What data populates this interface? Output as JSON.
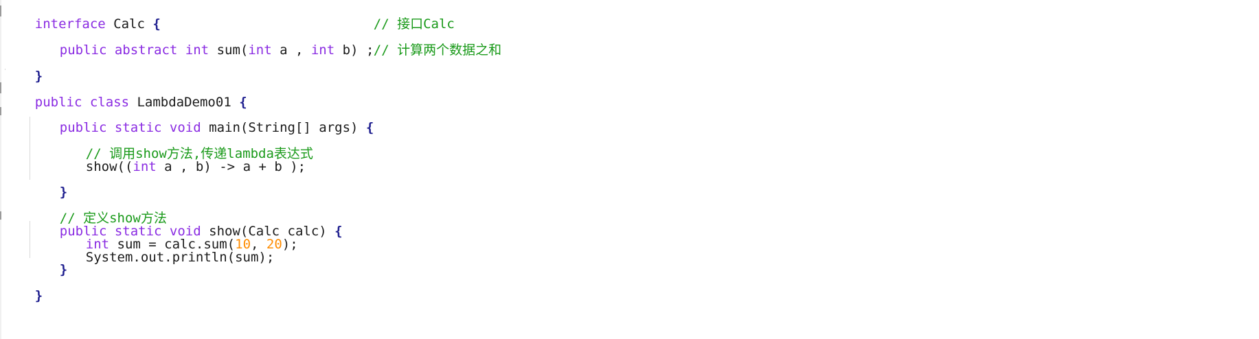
{
  "editor": {
    "lines": [
      {
        "kw": "interface",
        "rest": " Calc ",
        "brace": "{",
        "comment": "// 接口Calc"
      },
      {
        "kw1": "public",
        "kw2": " abstract",
        "ty": " int",
        "rest1": " sum(",
        "ty2": "int",
        "rest2": " a , ",
        "ty3": "int",
        "rest3": " b) ;",
        "comment": "// 计算两个数据之和"
      },
      {
        "brace": "}"
      },
      {
        "kw1": "public",
        "kw2": " class",
        "rest": " LambdaDemo01 ",
        "brace": "{"
      },
      {
        "kw1": "public",
        "kw2": " static",
        "ty": " void",
        "rest": " main(String[] args) ",
        "brace": "{"
      },
      {
        "comment": "// 调用show方法,传递lambda表达式"
      },
      {
        "rest1": "show((",
        "ty": "int",
        "rest2": " a , b) -> a + b );"
      },
      {
        "brace": "}"
      },
      {
        "comment": "// 定义show方法"
      },
      {
        "kw1": "public",
        "kw2": " static",
        "ty": " void",
        "rest": " show(Calc calc) ",
        "brace": "{"
      },
      {
        "ty": "int",
        "rest1": " sum = calc.sum(",
        "num1": "10",
        "rest2": ", ",
        "num2": "20",
        "rest3": ");"
      },
      {
        "rest": "System.out.println(sum);"
      },
      {
        "brace": "}"
      },
      {
        "brace": "}"
      }
    ]
  }
}
